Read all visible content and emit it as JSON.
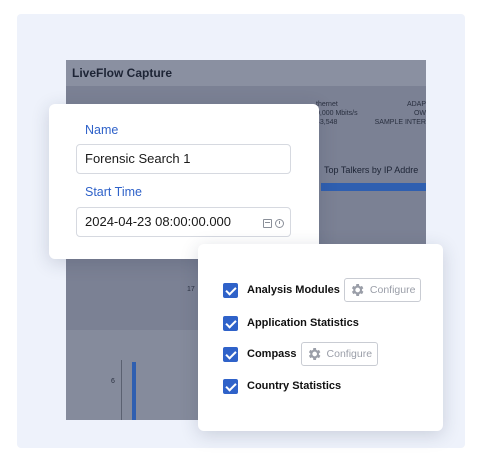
{
  "background_app": {
    "title": "LiveFlow Capture",
    "stats": {
      "ethernet_label": "thernet",
      "adapter_label": "ADAP",
      "speed": "0,000 Mbits/s",
      "owner_fragment": "OW",
      "count": "43,548",
      "sample_label": "SAMPLE INTER"
    },
    "top_talkers_label": "Top Talkers by IP Addre",
    "axis_values": [
      "17",
      "6"
    ]
  },
  "form": {
    "name_label": "Name",
    "name_value": "Forensic Search 1",
    "start_time_label": "Start Time",
    "start_time_value": "2024-04-23 08:00:00.000"
  },
  "options": {
    "configure_label": "Configure",
    "items": [
      {
        "label": "Analysis Modules",
        "checked": true,
        "has_configure": true
      },
      {
        "label": "Application Statistics",
        "checked": true,
        "has_configure": false
      },
      {
        "label": "Compass",
        "checked": true,
        "has_configure": true
      },
      {
        "label": "Country Statistics",
        "checked": true,
        "has_configure": false
      }
    ]
  },
  "colors": {
    "accent": "#2f62c9",
    "backdrop": "#eef2fb",
    "dimmed_app": "#7b8194"
  }
}
